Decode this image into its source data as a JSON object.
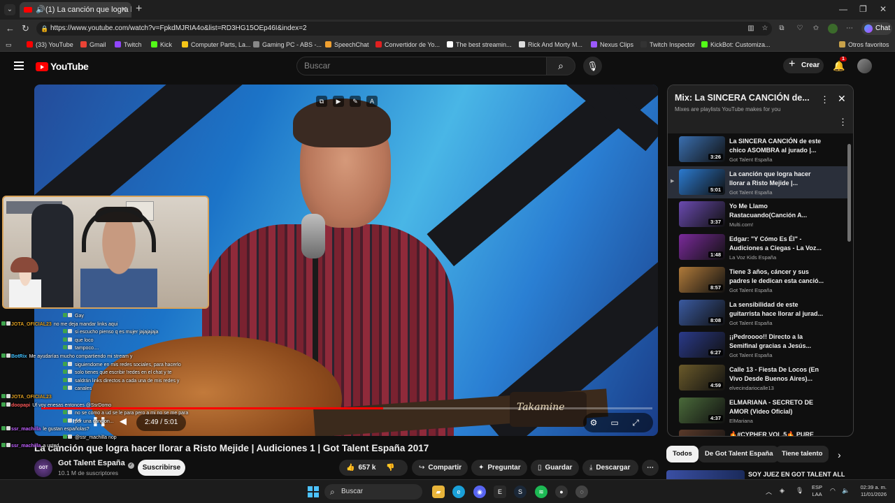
{
  "browser": {
    "tab_title": "(1) La canción que logra hacer",
    "url": "https://www.youtube.com/watch?v=FpkdMJRIA4o&list=RD3HG15OEp46I&index=2",
    "chat_button": "Chat",
    "bookmarks": [
      {
        "label": "(33) YouTube",
        "color": "#ff0000"
      },
      {
        "label": "Gmail",
        "color": "#ea4335"
      },
      {
        "label": "Twitch",
        "color": "#9146ff"
      },
      {
        "label": "Kick",
        "color": "#53fc18"
      },
      {
        "label": "Computer Parts, La...",
        "color": "#f5c518"
      },
      {
        "label": "Gaming PC - ABS -...",
        "color": "#888888"
      },
      {
        "label": "SpeechChat",
        "color": "#f0a030"
      },
      {
        "label": "Convertidor de Yo...",
        "color": "#e02020"
      },
      {
        "label": "The best streamin...",
        "color": "#ffffff"
      },
      {
        "label": "Rick And Morty M...",
        "color": "#dddddd"
      },
      {
        "label": "Nexus Clips",
        "color": "#9b59ff"
      },
      {
        "label": "Twitch Inspector",
        "color": "#333333"
      },
      {
        "label": "KickBot: Customiza...",
        "color": "#53fc18"
      }
    ],
    "other_bookmarks": "Otros favoritos"
  },
  "youtube": {
    "logo_text": "YouTube",
    "search_placeholder": "Buscar",
    "create_label": "Crear",
    "notification_count": "1"
  },
  "video": {
    "title": "La canción que logra hacer llorar a Risto Mejide | Audiciones 1 | Got Talent España 2017",
    "current_time": "2:49",
    "duration": "5:01",
    "time_display": "2:49 / 5:01",
    "progress_fraction": 0.56,
    "guitar_brand": "Takamine",
    "channel": {
      "name": "Got Talent España",
      "subscribers": "10.1 M de suscriptores",
      "avatar_text": "GOT TALENT"
    },
    "subscribe_label": "Suscribirse",
    "actions": {
      "likes": "657 k",
      "share": "Compartir",
      "ask": "Preguntar",
      "save": "Guardar",
      "download": "Descargar"
    }
  },
  "stream_chat": [
    {
      "user": "",
      "text": "Gay",
      "color": "#8bc34a"
    },
    {
      "user": "JOTA_OFICIAL23",
      "text": "no me deja mandar links aqui",
      "color": "#e0a020"
    },
    {
      "user": "",
      "text": "si escucho pienso q es mujer jajajajaja",
      "color": "#8bc34a"
    },
    {
      "user": "",
      "text": "que loco",
      "color": "#c060ff"
    },
    {
      "user": "",
      "text": "tampoco....",
      "color": "#8bc34a"
    },
    {
      "user": "BotRix",
      "text": "Me ayudarías mucho compartiendo mi stream y",
      "color": "#40c0ff"
    },
    {
      "user": "",
      "text": "siguiendome en mis redes sociales, para hacerlo",
      "color": "#40c0ff"
    },
    {
      "user": "",
      "text": "solo tienes que escribir !redes en el chat y te",
      "color": "#40c0ff"
    },
    {
      "user": "",
      "text": "saldrán links directos a cada una de mis redes y",
      "color": "#40c0ff"
    },
    {
      "user": "",
      "text": "canales",
      "color": "#40c0ff"
    },
    {
      "user": "JOTA_OFICIAL23",
      "text": "",
      "color": "#e0a020"
    },
    {
      "user": "doopapi",
      "text": "Uf voy enesas entonces @SsrDomo",
      "color": "#ff5a5a"
    },
    {
      "user": "",
      "text": "no se como a ud se le para pero a mi no se me para",
      "color": "#8bc34a"
    },
    {
      "user": "",
      "text": "por una cancion...",
      "color": "#8bc34a"
    },
    {
      "user": "ssr_machilla",
      "text": "le gustan españolas?",
      "color": "#c060ff"
    },
    {
      "user": "",
      "text": "@ssr_machilla nop",
      "color": "#8bc34a"
    },
    {
      "user": "ssr_machilla",
      "text": "a usted",
      "color": "#c060ff"
    }
  ],
  "playlist": {
    "title": "Mix: La SINCERA CANCIÓN de...",
    "subtitle": "Mixes are playlists YouTube makes for you",
    "items": [
      {
        "title": "La SINCERA CANCIÓN de este chico ASOMBRA al jurado |...",
        "channel": "Got Talent España",
        "duration": "3:26",
        "active": false,
        "thumb": "#3a6fb0"
      },
      {
        "title": "La canción que logra hacer llorar a Risto Mejide |...",
        "channel": "Got Talent España",
        "duration": "5:01",
        "active": true,
        "thumb": "#2b7ad0"
      },
      {
        "title": "Yo Me Llamo Rastacuando(Canción A...",
        "channel": "Multi.com!",
        "duration": "3:37",
        "active": false,
        "thumb": "#6a4ab0"
      },
      {
        "title": "Edgar: \"Y Cómo Es Él\" - Audiciones a Ciegas - La Voz...",
        "channel": "La Voz Kids España",
        "duration": "1:48",
        "active": false,
        "thumb": "#7a2a9a"
      },
      {
        "title": "Tiene 3 años, cáncer y sus padres le dedican esta canció...",
        "channel": "Got Talent España",
        "duration": "8:57",
        "active": false,
        "thumb": "#b07a3a"
      },
      {
        "title": "La sensibilidad de este guitarrista hace llorar al jurad...",
        "channel": "Got Talent España",
        "duration": "8:08",
        "active": false,
        "thumb": "#3a5aa0"
      },
      {
        "title": "¡¡Pedroooo!! Directo a la Semifinal gracias a Jesús...",
        "channel": "Got Talent España",
        "duration": "6:27",
        "active": false,
        "thumb": "#2a3a8a"
      },
      {
        "title": "Calle 13 - Fiesta De Locos (En Vivo Desde Buenos Aires)...",
        "channel": "elvecindariocalle13",
        "duration": "4:59",
        "active": false,
        "thumb": "#6a5a2a"
      },
      {
        "title": "ELMARIANA - SECRETO DE AMOR (Video Oficial)",
        "channel": "ElMariana",
        "duration": "4:37",
        "active": false,
        "thumb": "#4a6a3a"
      },
      {
        "title": "🔥#CYPHER VOL.5🔥 PURE",
        "channel": "",
        "duration": "",
        "active": false,
        "thumb": "#5a3a2a"
      }
    ]
  },
  "chips": [
    "Todos",
    "De Got Talent España",
    "Tiene talento"
  ],
  "next_video": {
    "title": "SOY JUEZ EN GOT TALENT ALL"
  },
  "taskbar": {
    "search": "Buscar",
    "lang_line1": "ESP",
    "lang_line2": "LAA",
    "time": "02:39 a. m.",
    "date": "11/01/2026"
  }
}
